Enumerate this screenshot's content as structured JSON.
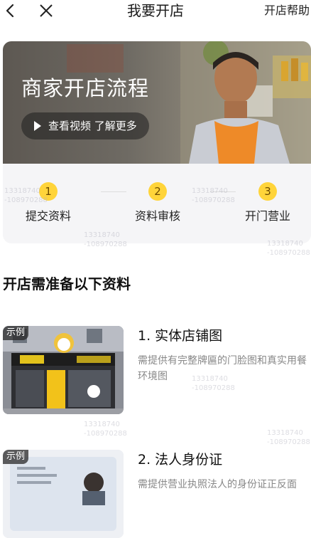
{
  "header": {
    "title": "我要开店",
    "help_label": "开店帮助",
    "back_icon": "back-arrow-icon",
    "close_icon": "close-icon"
  },
  "banner": {
    "title": "商家开店流程",
    "video_button_label": "查看视频 了解更多",
    "play_icon": "play-icon"
  },
  "steps": [
    {
      "number": "1",
      "label": "提交资料"
    },
    {
      "number": "2",
      "label": "资料审核"
    },
    {
      "number": "3",
      "label": "开门营业"
    }
  ],
  "section": {
    "title": "开店需准备以下资料"
  },
  "requirements": [
    {
      "tag": "示例",
      "title": "1. 实体店铺图",
      "description": "需提供有完整牌匾的门脸图和真实用餐环境图"
    },
    {
      "tag": "示例",
      "title": "2. 法人身份证",
      "description": "需提供营业执照法人的身份证正反面"
    }
  ],
  "watermark": {
    "line1": "13318740",
    "line2": "-108970288"
  },
  "colors": {
    "step_badge": "#ffd43a",
    "step_panel": "#f5f5f7",
    "secondary_text": "#888888"
  }
}
